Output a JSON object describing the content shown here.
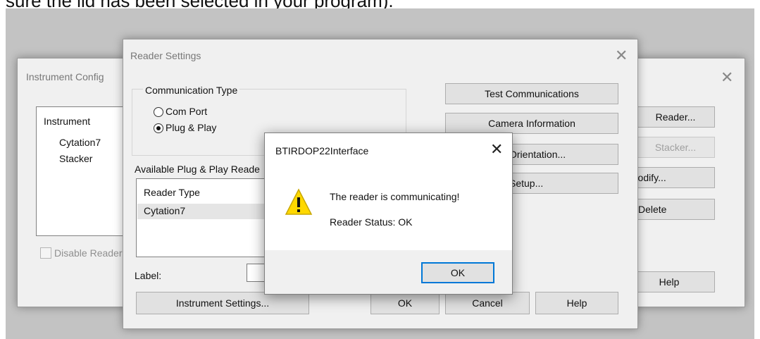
{
  "doc_snippet": "sure the lid has been selected in your program).",
  "instrument_config": {
    "title": "Instrument Config",
    "list_header": "Instrument",
    "items": [
      "Cytation7",
      "Stacker"
    ],
    "buttons": {
      "reader": "Reader...",
      "stacker": "Stacker...",
      "modify": "/Modify...",
      "delete": "Delete",
      "help": "Help"
    },
    "disable_reader_label": "Disable Reader"
  },
  "reader_settings": {
    "title": "Reader Settings",
    "comm_group_label": "Communication Type",
    "radio_com_port": "Com Port",
    "radio_plug_play": "Plug & Play",
    "available_label": "Available Plug & Play Reade",
    "list_header": "Reader Type",
    "list_item": "Cytation7",
    "label_label": "Label:",
    "buttons": {
      "test_comm": "Test Communications",
      "camera_info": "Camera Information",
      "orientation": "Orientation...",
      "setup": "Setup...",
      "instrument_settings": "Instrument Settings...",
      "ok": "OK",
      "cancel": "Cancel",
      "help": "Help"
    }
  },
  "message_box": {
    "title": "BTIRDOP22Interface",
    "line1": "The reader is communicating!",
    "line2": "Reader Status: OK",
    "ok": "OK",
    "icon": "warning-icon"
  }
}
